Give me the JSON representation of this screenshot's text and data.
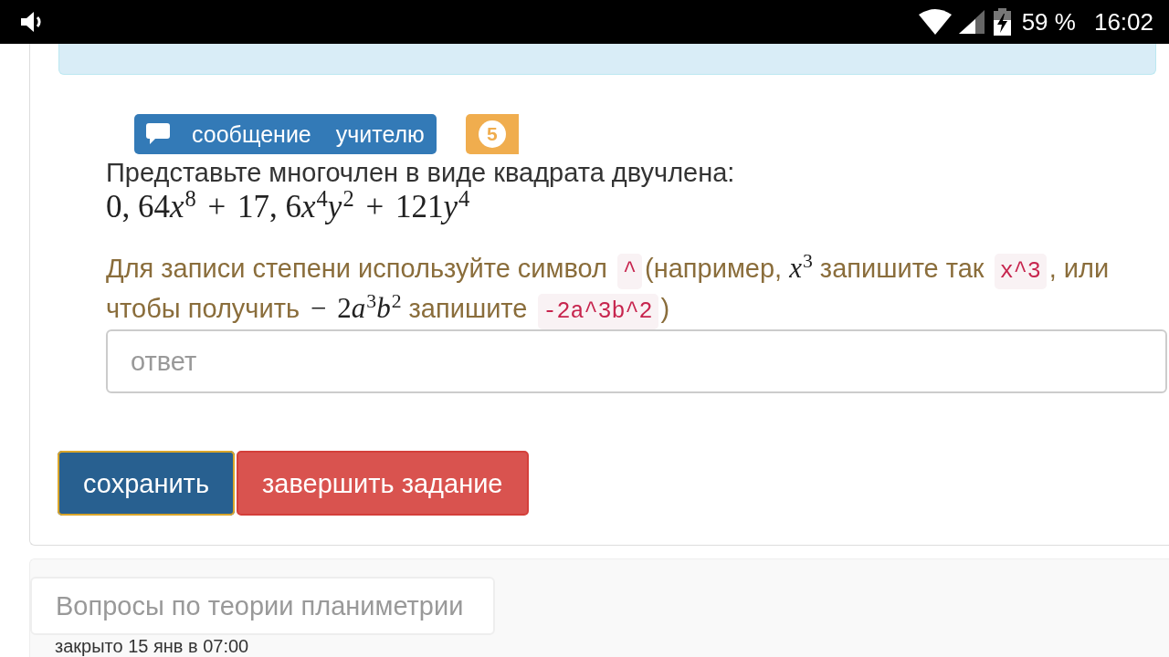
{
  "status_bar": {
    "battery": "59 %",
    "time": "16:02"
  },
  "task": {
    "message_button": {
      "label": "сообщение учителю"
    },
    "badge": "5",
    "question": "Представьте многочлен в виде квадрата двучлена:",
    "formula": [
      {
        "kind": "number",
        "text": "0, 64"
      },
      {
        "kind": "variable",
        "text": "x"
      },
      {
        "kind": "power",
        "text": "8"
      },
      {
        "kind": "operator",
        "text": "+"
      },
      {
        "kind": "number",
        "text": "17, 6"
      },
      {
        "kind": "variable",
        "text": "x"
      },
      {
        "kind": "power",
        "text": "4"
      },
      {
        "kind": "variable",
        "text": "y"
      },
      {
        "kind": "power",
        "text": "2"
      },
      {
        "kind": "operator",
        "text": "+"
      },
      {
        "kind": "number",
        "text": "121"
      },
      {
        "kind": "variable",
        "text": "y"
      },
      {
        "kind": "power",
        "text": "4"
      }
    ],
    "hint": [
      {
        "kind": "text",
        "text": "Для записи степени используйте символ "
      },
      {
        "kind": "code",
        "text": "^"
      },
      {
        "kind": "text",
        "text": "(например, "
      },
      {
        "kind": "math",
        "parts": [
          {
            "kind": "variable",
            "text": "x"
          },
          {
            "kind": "power",
            "text": "3"
          }
        ]
      },
      {
        "kind": "text",
        "text": " запишите так "
      },
      {
        "kind": "code",
        "text": "x^3"
      },
      {
        "kind": "text",
        "text": ", или чтобы получить "
      },
      {
        "kind": "math",
        "parts": [
          {
            "kind": "operator",
            "text": "−"
          },
          {
            "kind": "number",
            "text": "2"
          },
          {
            "kind": "variable",
            "text": "a"
          },
          {
            "kind": "power",
            "text": "3"
          },
          {
            "kind": "variable",
            "text": "b"
          },
          {
            "kind": "power",
            "text": "2"
          }
        ]
      },
      {
        "kind": "text",
        "text": " запишите "
      },
      {
        "kind": "code",
        "text": "-2a^3b^2"
      },
      {
        "kind": "text",
        "text": ")"
      }
    ],
    "answer": {
      "placeholder": "ответ"
    },
    "buttons": [
      {
        "label": "сохранить",
        "kind": "primary",
        "focused": true
      },
      {
        "label": "завершить задание",
        "kind": "danger",
        "focused": false
      }
    ]
  },
  "other_tasks": [
    {
      "title": "Вопросы по теории планиметрии",
      "status": "закрыто 15 янв в 07:00"
    }
  ]
}
